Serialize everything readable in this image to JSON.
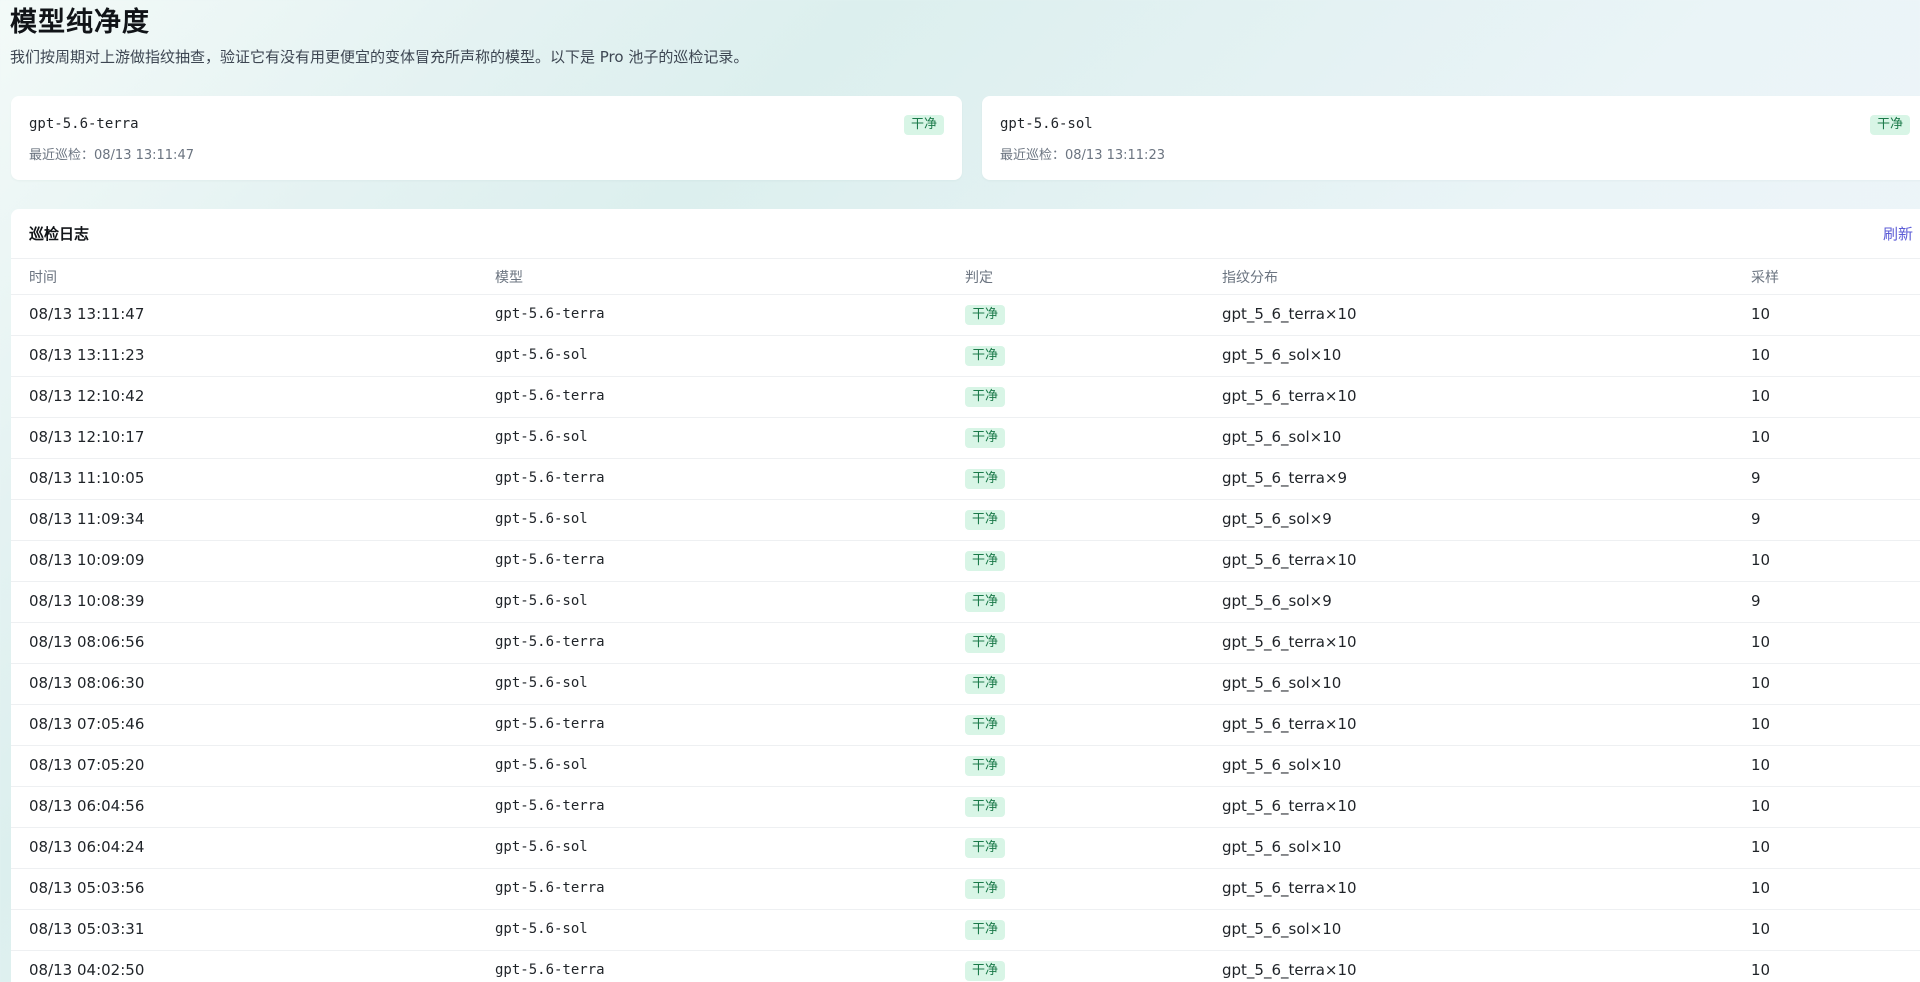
{
  "page": {
    "title": "模型纯净度",
    "description": "我们按周期对上游做指纹抽查，验证它有没有用更便宜的变体冒充所声称的模型。以下是 Pro 池子的巡检记录。"
  },
  "cards": [
    {
      "model": "gpt-5.6-terra",
      "status": "干净",
      "last_check": "最近巡检：08/13 13:11:47"
    },
    {
      "model": "gpt-5.6-sol",
      "status": "干净",
      "last_check": "最近巡检：08/13 13:11:23"
    }
  ],
  "log": {
    "title": "巡检日志",
    "refresh_label": "刷新",
    "columns": {
      "time": "时间",
      "model": "模型",
      "verdict": "判定",
      "fingerprint": "指纹分布",
      "sample": "采样"
    },
    "rows": [
      {
        "time": "08/13 13:11:47",
        "model": "gpt-5.6-terra",
        "verdict": "干净",
        "fingerprint": "gpt_5_6_terra×10",
        "sample": "10"
      },
      {
        "time": "08/13 13:11:23",
        "model": "gpt-5.6-sol",
        "verdict": "干净",
        "fingerprint": "gpt_5_6_sol×10",
        "sample": "10"
      },
      {
        "time": "08/13 12:10:42",
        "model": "gpt-5.6-terra",
        "verdict": "干净",
        "fingerprint": "gpt_5_6_terra×10",
        "sample": "10"
      },
      {
        "time": "08/13 12:10:17",
        "model": "gpt-5.6-sol",
        "verdict": "干净",
        "fingerprint": "gpt_5_6_sol×10",
        "sample": "10"
      },
      {
        "time": "08/13 11:10:05",
        "model": "gpt-5.6-terra",
        "verdict": "干净",
        "fingerprint": "gpt_5_6_terra×9",
        "sample": "9"
      },
      {
        "time": "08/13 11:09:34",
        "model": "gpt-5.6-sol",
        "verdict": "干净",
        "fingerprint": "gpt_5_6_sol×9",
        "sample": "9"
      },
      {
        "time": "08/13 10:09:09",
        "model": "gpt-5.6-terra",
        "verdict": "干净",
        "fingerprint": "gpt_5_6_terra×10",
        "sample": "10"
      },
      {
        "time": "08/13 10:08:39",
        "model": "gpt-5.6-sol",
        "verdict": "干净",
        "fingerprint": "gpt_5_6_sol×9",
        "sample": "9"
      },
      {
        "time": "08/13 08:06:56",
        "model": "gpt-5.6-terra",
        "verdict": "干净",
        "fingerprint": "gpt_5_6_terra×10",
        "sample": "10"
      },
      {
        "time": "08/13 08:06:30",
        "model": "gpt-5.6-sol",
        "verdict": "干净",
        "fingerprint": "gpt_5_6_sol×10",
        "sample": "10"
      },
      {
        "time": "08/13 07:05:46",
        "model": "gpt-5.6-terra",
        "verdict": "干净",
        "fingerprint": "gpt_5_6_terra×10",
        "sample": "10"
      },
      {
        "time": "08/13 07:05:20",
        "model": "gpt-5.6-sol",
        "verdict": "干净",
        "fingerprint": "gpt_5_6_sol×10",
        "sample": "10"
      },
      {
        "time": "08/13 06:04:56",
        "model": "gpt-5.6-terra",
        "verdict": "干净",
        "fingerprint": "gpt_5_6_terra×10",
        "sample": "10"
      },
      {
        "time": "08/13 06:04:24",
        "model": "gpt-5.6-sol",
        "verdict": "干净",
        "fingerprint": "gpt_5_6_sol×10",
        "sample": "10"
      },
      {
        "time": "08/13 05:03:56",
        "model": "gpt-5.6-terra",
        "verdict": "干净",
        "fingerprint": "gpt_5_6_terra×10",
        "sample": "10"
      },
      {
        "time": "08/13 05:03:31",
        "model": "gpt-5.6-sol",
        "verdict": "干净",
        "fingerprint": "gpt_5_6_sol×10",
        "sample": "10"
      },
      {
        "time": "08/13 04:02:50",
        "model": "gpt-5.6-terra",
        "verdict": "干净",
        "fingerprint": "gpt_5_6_terra×10",
        "sample": "10"
      }
    ]
  },
  "colors": {
    "badge_bg": "#d8f5e6",
    "badge_text": "#1b7a4a",
    "accent_link": "#5b5bd6"
  }
}
